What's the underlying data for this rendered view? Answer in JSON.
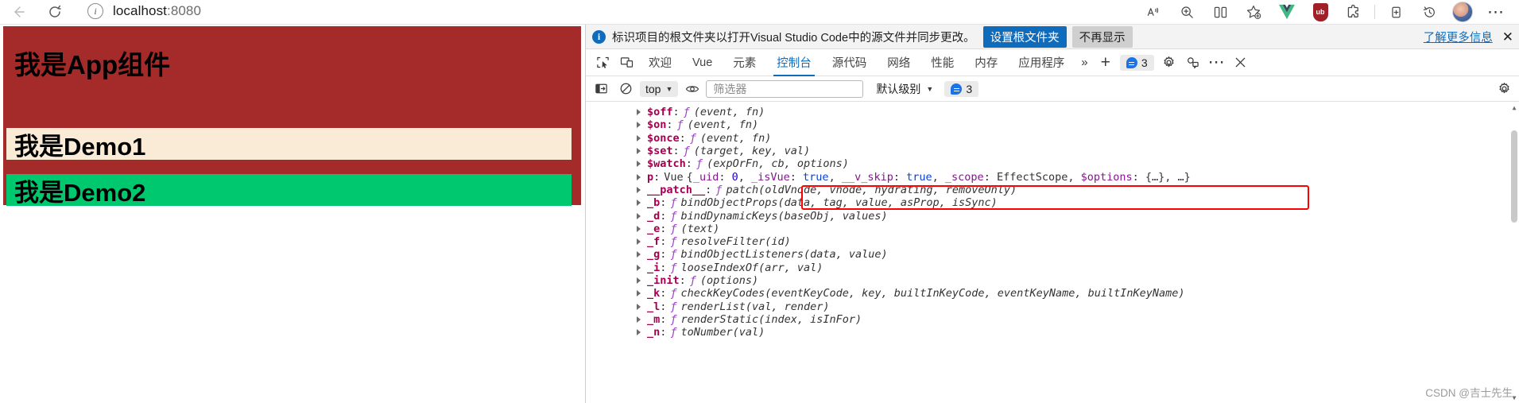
{
  "browser": {
    "back_label": "back-arrow",
    "reload_label": "reload",
    "url": "localhost",
    "url_port": ":8080",
    "info_glyph": "i",
    "toolbar_icons": [
      {
        "name": "read-aloud-icon",
        "glyph": "A"
      },
      {
        "name": "zoom-icon",
        "glyph": "+"
      },
      {
        "name": "split-screen-icon",
        "glyph": "[]"
      },
      {
        "name": "add-favorite-icon",
        "glyph": "star"
      },
      {
        "name": "vue-devtools-extension-icon",
        "glyph": "V"
      },
      {
        "name": "ublock-extension-icon",
        "glyph": "ub"
      },
      {
        "name": "extensions-icon",
        "glyph": "puzzle"
      },
      {
        "name": "collections-icon",
        "glyph": "collections"
      },
      {
        "name": "history-icon",
        "glyph": "history"
      },
      {
        "name": "profile-avatar",
        "glyph": "avatar"
      },
      {
        "name": "settings-and-more-icon",
        "glyph": "..."
      }
    ]
  },
  "page": {
    "app_title": "我是App组件",
    "demo1_title": "我是Demo1",
    "demo2_title": "我是Demo2",
    "colors": {
      "app_bg": "#a52a2a",
      "demo1_bg": "#faebd7",
      "demo2_bg": "#00c86f"
    }
  },
  "devtools": {
    "infobar": {
      "icon": "info-icon",
      "message": "标识项目的根文件夹以打开Visual Studio Code中的源文件并同步更改。",
      "primary_button": "设置根文件夹",
      "secondary_button": "不再显示",
      "link": "了解更多信息",
      "close": "✕"
    },
    "tabs": [
      {
        "label": "欢迎",
        "active": false
      },
      {
        "label": "Vue",
        "active": false
      },
      {
        "label": "元素",
        "active": false
      },
      {
        "label": "控制台",
        "active": true
      },
      {
        "label": "源代码",
        "active": false
      },
      {
        "label": "网络",
        "active": false
      },
      {
        "label": "性能",
        "active": false
      },
      {
        "label": "内存",
        "active": false
      },
      {
        "label": "应用程序",
        "active": false
      }
    ],
    "tab_overflow": "»",
    "add_tab": "+",
    "message_badge_count": "3",
    "tabstrip_icons": [
      {
        "name": "inspect-element-icon"
      },
      {
        "name": "device-emulation-icon"
      },
      {
        "name": "devtools-settings-gear-icon"
      },
      {
        "name": "devtools-customize-icon"
      },
      {
        "name": "devtools-more-options-icon"
      },
      {
        "name": "devtools-close-icon"
      }
    ],
    "console_toolbar": {
      "sidebar_toggle": "console-sidebar-icon",
      "clear_console": "clear-console-icon",
      "context_value": "top",
      "live_expression": "live-expression-icon",
      "filter_placeholder": "筛选器",
      "filter_value": "",
      "level_value": "默认级别",
      "issues_count": "3",
      "settings": "console-settings-gear-icon"
    },
    "console_rows": [
      {
        "prop": "$off",
        "kind": "fn",
        "sig": "(event, fn)"
      },
      {
        "prop": "$on",
        "kind": "fn",
        "sig": "(event, fn)"
      },
      {
        "prop": "$once",
        "kind": "fn",
        "sig": "(event, fn)"
      },
      {
        "prop": "$set",
        "kind": "fn",
        "sig": "(target, key, val)"
      },
      {
        "prop": "$watch",
        "kind": "fn",
        "sig": "(expOrFn, cb, options)"
      },
      {
        "prop": "p",
        "kind": "obj",
        "class": "Vue",
        "body": "{_uid: 0, _isVue: true, __v_skip: true, _scope: EffectScope, $options: {…}, …}",
        "highlighted": true
      },
      {
        "prop": "__patch__",
        "kind": "fn",
        "sig": "patch(oldVnode, vnode, hydrating, removeOnly)"
      },
      {
        "prop": "_b",
        "kind": "fn",
        "sig": "bindObjectProps(data, tag, value, asProp, isSync)"
      },
      {
        "prop": "_d",
        "kind": "fn",
        "sig": "bindDynamicKeys(baseObj, values)"
      },
      {
        "prop": "_e",
        "kind": "fn",
        "sig": "(text)"
      },
      {
        "prop": "_f",
        "kind": "fn",
        "sig": "resolveFilter(id)"
      },
      {
        "prop": "_g",
        "kind": "fn",
        "sig": "bindObjectListeners(data, value)"
      },
      {
        "prop": "_i",
        "kind": "fn",
        "sig": "looseIndexOf(arr, val)"
      },
      {
        "prop": "_init",
        "kind": "fn",
        "sig": "(options)"
      },
      {
        "prop": "_k",
        "kind": "fn",
        "sig": "checkKeyCodes(eventKeyCode, key, builtInKeyCode, eventKeyName, builtInKeyName)"
      },
      {
        "prop": "_l",
        "kind": "fn",
        "sig": "renderList(val, render)"
      },
      {
        "prop": "_m",
        "kind": "fn",
        "sig": "renderStatic(index, isInFor)"
      },
      {
        "prop": "_n",
        "kind": "fn",
        "sig": "toNumber(val)"
      }
    ],
    "annotation": {
      "color": "#ff0000",
      "target_row_prop": "p"
    }
  },
  "watermark": "CSDN @吉士先生"
}
